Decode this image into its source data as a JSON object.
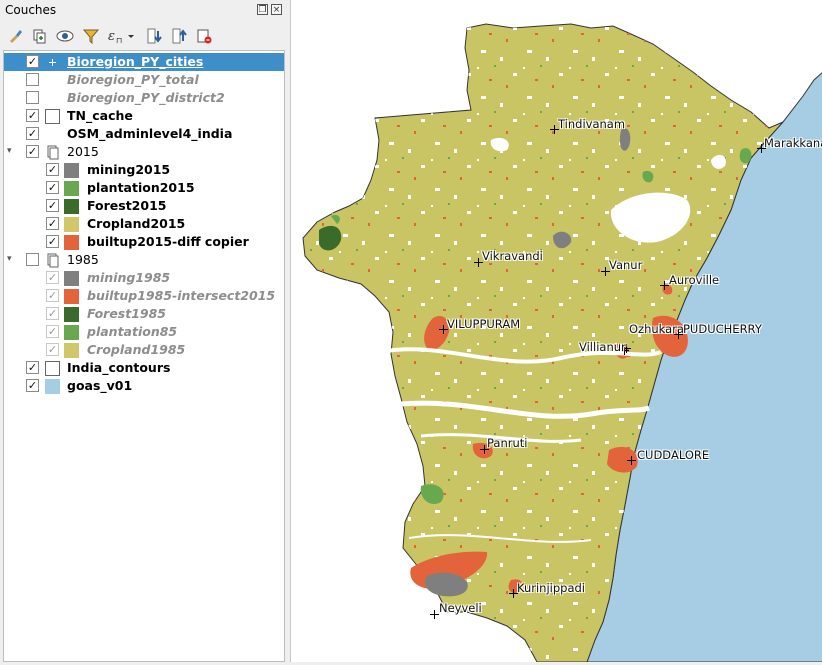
{
  "panel": {
    "title": "Couches",
    "float_icon": "float-icon",
    "close_icon": "close-icon"
  },
  "toolbar": [
    {
      "name": "style-brush-icon"
    },
    {
      "name": "add-group-icon"
    },
    {
      "name": "eye-visibility-icon"
    },
    {
      "name": "filter-icon"
    },
    {
      "name": "expression-filter-icon"
    },
    {
      "name": "expand-all-icon"
    },
    {
      "name": "collapse-all-icon"
    },
    {
      "name": "remove-layer-icon"
    }
  ],
  "layers": [
    {
      "label": "Bioregion_PY_cities",
      "checked": true,
      "selected": true,
      "style": "bold",
      "symbol": "point"
    },
    {
      "label": "Bioregion_PY_total",
      "checked": false,
      "style": "italic",
      "symbol": "blank"
    },
    {
      "label": "Bioregion_PY_district2",
      "checked": false,
      "style": "italic",
      "symbol": "blank"
    },
    {
      "label": "TN_cache",
      "checked": true,
      "style": "bold",
      "symbol": "empty"
    },
    {
      "label": "OSM_adminlevel4_india",
      "checked": true,
      "style": "bold",
      "symbol": "blank"
    },
    {
      "label": "2015",
      "checked": true,
      "group": true,
      "style": "normal"
    },
    {
      "label": "mining2015",
      "checked": true,
      "style": "bold",
      "color": "#7f7f7f"
    },
    {
      "label": "plantation2015",
      "checked": true,
      "style": "bold",
      "color": "#6aa84f"
    },
    {
      "label": "Forest2015",
      "checked": true,
      "style": "bold",
      "color": "#3b6b2b"
    },
    {
      "label": "Cropland2015",
      "checked": true,
      "style": "bold",
      "color": "#cfc76a"
    },
    {
      "label": "builtup2015-diff copier",
      "checked": true,
      "style": "bold",
      "color": "#e3643a"
    },
    {
      "label": "1985",
      "checked": false,
      "group": true,
      "style": "normal"
    },
    {
      "label": "mining1985",
      "checked": true,
      "style": "italic",
      "color": "#7f7f7f"
    },
    {
      "label": "builtup1985-intersect2015",
      "checked": true,
      "style": "italic",
      "color": "#e3643a"
    },
    {
      "label": "Forest1985",
      "checked": true,
      "style": "italic",
      "color": "#3b6b2b"
    },
    {
      "label": "plantation85",
      "checked": true,
      "style": "italic",
      "color": "#6aa84f"
    },
    {
      "label": "Cropland1985",
      "checked": true,
      "style": "italic",
      "color": "#cfc76a"
    },
    {
      "label": "India_contours",
      "checked": true,
      "style": "bold",
      "symbol": "empty"
    },
    {
      "label": "goas_v01",
      "checked": true,
      "style": "bold",
      "color": "#a6cde3"
    }
  ],
  "map": {
    "land_color": "#cac564",
    "sea_color": "#a6cde3",
    "builtup_color": "#e3643a",
    "mining_color": "#7f7f7f",
    "forest_color": "#3b6b2b",
    "plantation_color": "#6aa84f",
    "cities": [
      {
        "name": "Tindivanam"
      },
      {
        "name": "Marakkanam"
      },
      {
        "name": "Vikravandi"
      },
      {
        "name": "Vanur"
      },
      {
        "name": "Auroville"
      },
      {
        "name": "VILUPPURAM"
      },
      {
        "name": "Ozhukarai"
      },
      {
        "name": "PUDUCHERRY"
      },
      {
        "name": "Villianur"
      },
      {
        "name": "Panruti"
      },
      {
        "name": "CUDDALORE"
      },
      {
        "name": "Kurinjippadi"
      },
      {
        "name": "Neyveli"
      }
    ]
  }
}
